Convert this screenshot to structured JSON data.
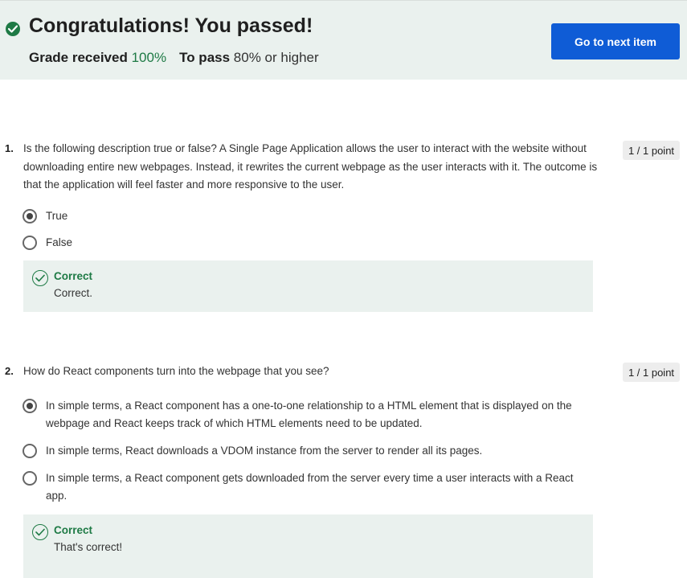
{
  "banner": {
    "title": "Congratulations! You passed!",
    "grade_label": "Grade received",
    "grade_value": "100%",
    "pass_label": "To pass",
    "pass_value": "80% or higher",
    "next_button": "Go to next item",
    "icon": "check-circle-icon"
  },
  "questions": [
    {
      "number": "1.",
      "text": "Is the following description true or false? A Single Page Application allows the user to interact with the website without downloading entire new webpages. Instead, it rewrites the current webpage as the user interacts with it. The outcome is that the application will feel faster and more responsive to the user.",
      "points": "1 / 1 point",
      "options": [
        {
          "label": "True",
          "selected": true
        },
        {
          "label": "False",
          "selected": false
        }
      ],
      "feedback": {
        "title": "Correct",
        "text": "Correct."
      }
    },
    {
      "number": "2.",
      "text": "How do React components turn into the webpage that you see?",
      "points": "1 / 1 point",
      "options": [
        {
          "label": "In simple terms, a React component has a one-to-one relationship to a HTML element that is displayed on the webpage and React keeps track of which HTML elements need to be updated.",
          "selected": true
        },
        {
          "label": "In simple terms, React downloads a VDOM instance from the server to render all its pages.",
          "selected": false
        },
        {
          "label": "In simple terms, a React component gets downloaded from the server every time a user interacts with a React app.",
          "selected": false
        }
      ],
      "feedback": {
        "title": "Correct",
        "text": "That's correct!"
      }
    }
  ],
  "colors": {
    "banner_bg": "#eaf1ee",
    "success_green": "#1e7a45",
    "primary_blue": "#0f5cd6",
    "points_bg": "#ededed"
  }
}
